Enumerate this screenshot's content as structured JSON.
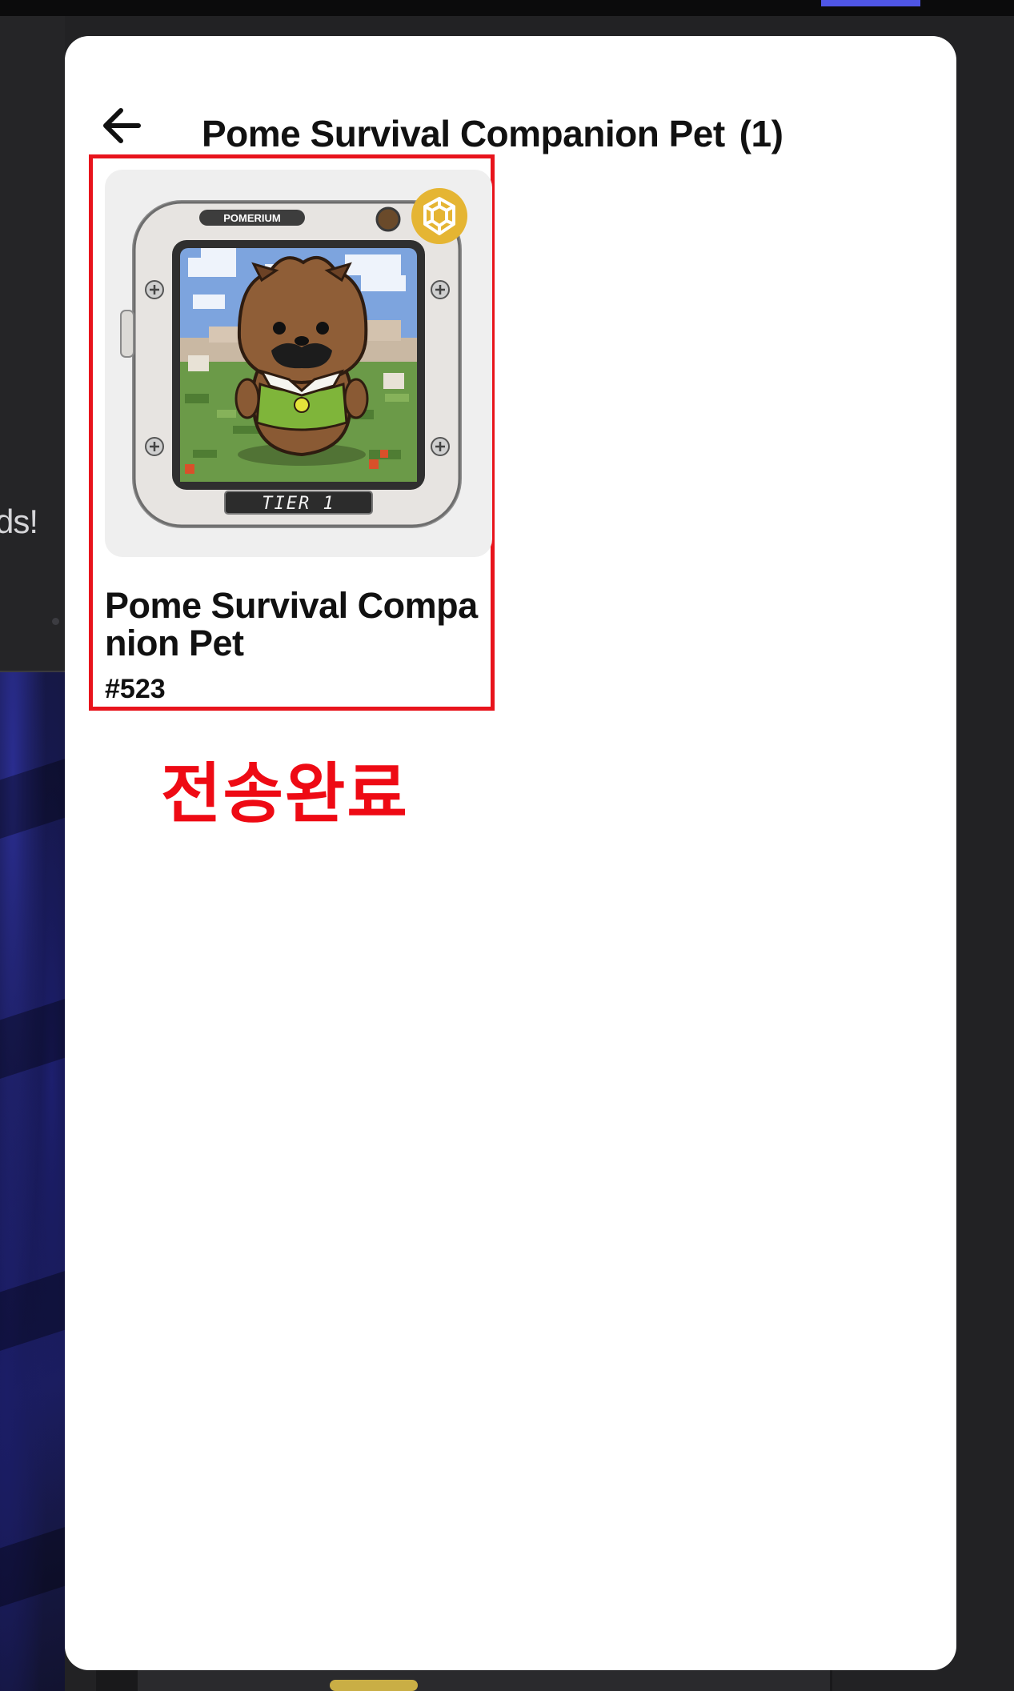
{
  "background": {
    "side_text_fragment": "ds!"
  },
  "modal": {
    "title": "Pome Survival Companion Pet",
    "count": "(1)",
    "back_icon": "arrow-left-icon"
  },
  "items": [
    {
      "name": "Pome Survival Companion Pet",
      "token_id": "#523",
      "image": {
        "frame_label": "POMERIUM",
        "tier_label": "TIER 1",
        "chain_badge_icon": "bnb-chain-icon"
      }
    }
  ],
  "annotation": {
    "text": "전송완료",
    "color": "#ee0a14"
  },
  "colors": {
    "highlight_border": "#e8141c",
    "accent_bar": "#4f56e6",
    "bnb_gold": "#e5b533"
  }
}
